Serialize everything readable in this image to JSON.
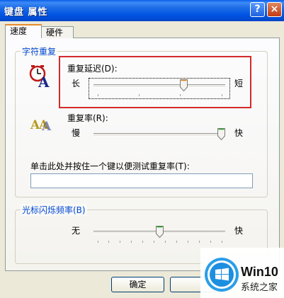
{
  "window": {
    "title": "键盘 属性",
    "help_glyph": "?",
    "close_glyph": "×"
  },
  "tabs": [
    {
      "label": "速度"
    },
    {
      "label": "硬件"
    }
  ],
  "char_repeat": {
    "group_label": "字符重复",
    "delay": {
      "label": "重复延迟(D):",
      "min_label": "长",
      "max_label": "短",
      "value_fraction": 0.7
    },
    "rate": {
      "label": "重复率(R):",
      "min_label": "慢",
      "max_label": "快",
      "value_fraction": 1.0
    },
    "test": {
      "label": "单击此处并按住一个键以便测试重复率(T):",
      "value": ""
    }
  },
  "cursor_blink": {
    "group_label": "光标闪烁频率(B)",
    "min_label": "无",
    "max_label": "快",
    "value_fraction": 0.5
  },
  "buttons": {
    "ok": "确定",
    "cancel": ""
  },
  "watermark": {
    "brand": "Win10",
    "site": "系统之家"
  },
  "colors": {
    "title_bar": "#0054e3",
    "group_label": "#0046d5",
    "highlight": "#d42a2a"
  }
}
